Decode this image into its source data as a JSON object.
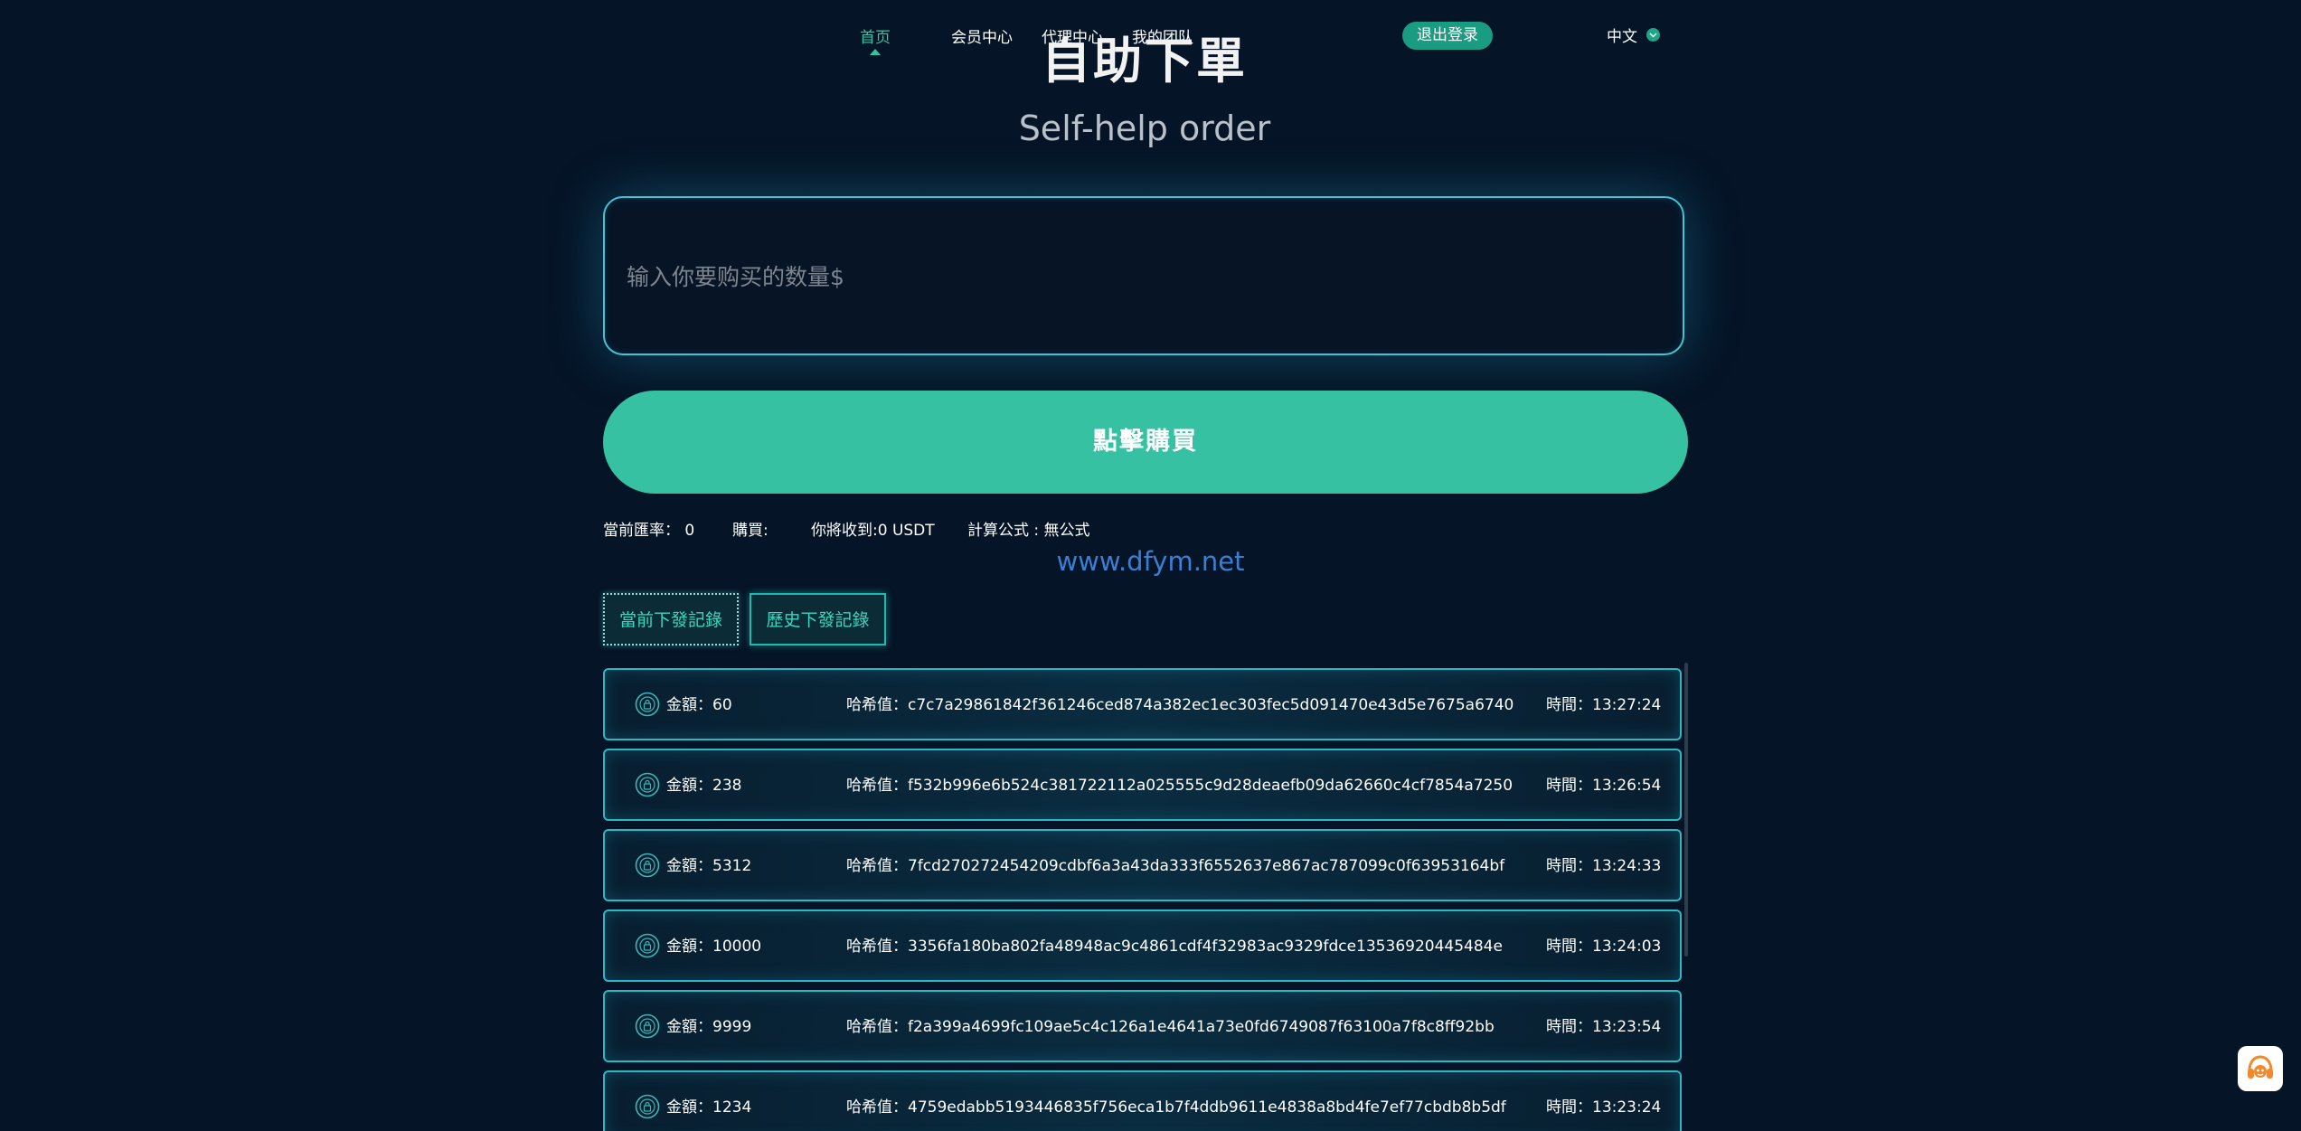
{
  "nav": {
    "items": [
      {
        "label": "首页",
        "active": true
      },
      {
        "label": "会员中心",
        "active": false
      },
      {
        "label": "代理中心",
        "active": false
      },
      {
        "label": "我的团队",
        "active": false
      }
    ],
    "logout_label": "退出登录",
    "language": "中文"
  },
  "header": {
    "title_cn": "自助下單",
    "title_en": "Self-help order"
  },
  "order": {
    "quantity_value": "",
    "quantity_placeholder": "输入你要购买的数量$",
    "buy_label": "點擊購買"
  },
  "info": {
    "rate": "當前匯率： 0",
    "buy": "購買:",
    "receive": "你將收到:0 USDT",
    "formula": "計算公式 : 無公式"
  },
  "watermark": "www.dfym.net",
  "tabs": {
    "current": "當前下發記錄",
    "history": "歷史下發記錄"
  },
  "records": [
    {
      "amount": "金額：60",
      "hash": "哈希值：c7c7a29861842f361246ced874a382ec1ec303fec5d091470e43d5e7675a6740",
      "time": "時間：13:27:24"
    },
    {
      "amount": "金額：238",
      "hash": "哈希值：f532b996e6b524c381722112a025555c9d28deaefb09da62660c4cf7854a7250",
      "time": "時間：13:26:54"
    },
    {
      "amount": "金額：5312",
      "hash": "哈希值：7fcd270272454209cdbf6a3a43da333f6552637e867ac787099c0f63953164bf",
      "time": "時間：13:24:33"
    },
    {
      "amount": "金額：10000",
      "hash": "哈希值：3356fa180ba802fa48948ac9c4861cdf4f32983ac9329fdce13536920445484e",
      "time": "時間：13:24:03"
    },
    {
      "amount": "金額：9999",
      "hash": "哈希值：f2a399a4699fc109ae5c4c126a1e4641a73e0fd6749087f63100a7f8c8ff92bb",
      "time": "時間：13:23:54"
    },
    {
      "amount": "金額：1234",
      "hash": "哈希值：4759edabb5193446835f756eca1b7f4ddb9611e4838a8bd4fe7ef77cbdb8b5df",
      "time": "時間：13:23:24"
    }
  ],
  "colors": {
    "background": "#051426",
    "accent": "#36c2a2",
    "border_glow": "#3ec6d6",
    "watermark": "#3a7fd1"
  },
  "icons": {
    "record": "coin-lock-icon",
    "language": "chevron-down-icon",
    "support": "headset-icon"
  }
}
